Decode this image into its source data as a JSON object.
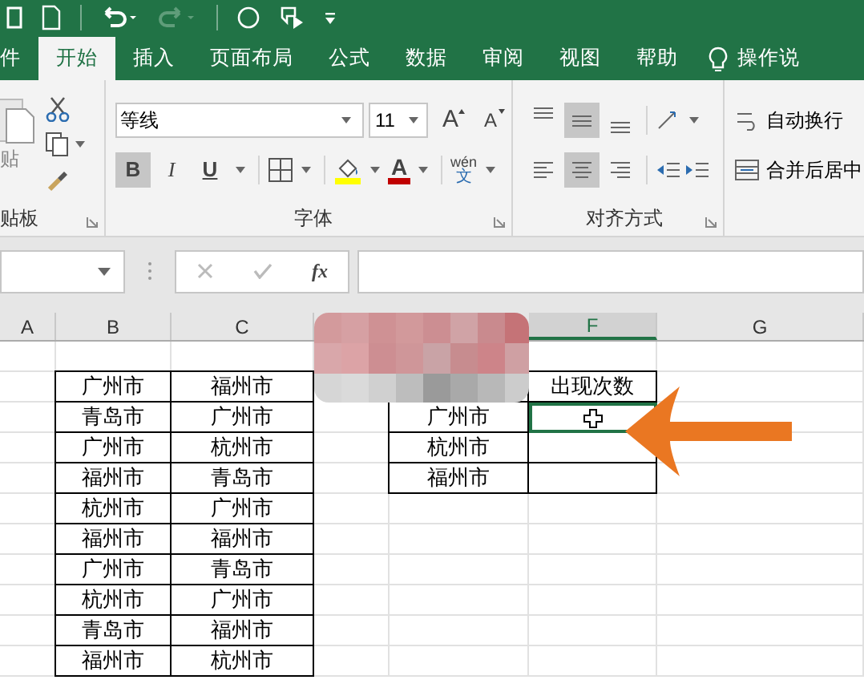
{
  "tabs": [
    {
      "label": "件",
      "selected": false
    },
    {
      "label": "开始",
      "selected": true
    },
    {
      "label": "插入",
      "selected": false
    },
    {
      "label": "页面布局",
      "selected": false
    },
    {
      "label": "公式",
      "selected": false
    },
    {
      "label": "数据",
      "selected": false
    },
    {
      "label": "审阅",
      "selected": false
    },
    {
      "label": "视图",
      "selected": false
    },
    {
      "label": "帮助",
      "selected": false
    }
  ],
  "tell_me": "操作说",
  "clipboard": {
    "paste_label": "贴",
    "group_label": "贴板"
  },
  "font": {
    "font_name": "等线",
    "font_size": "11",
    "grow": "A",
    "shrink": "A",
    "format_buttons": [
      {
        "kind": "bold",
        "label": "B",
        "selected": true
      },
      {
        "kind": "italic",
        "label": "I",
        "selected": false
      },
      {
        "kind": "underline",
        "label": "U",
        "selected": false
      }
    ],
    "font_color_letter": "A",
    "phonetic": "wén",
    "phonetic_char": "文",
    "group_label": "字体"
  },
  "alignment": {
    "vertical": [
      {
        "selected": false
      },
      {
        "selected": true
      },
      {
        "selected": false
      }
    ],
    "horizontal": [
      {
        "selected": false
      },
      {
        "selected": true
      },
      {
        "selected": false
      }
    ],
    "group_label": "对齐方式",
    "wrap_text": "自动换行",
    "merge_center": "合并后居中"
  },
  "formula_bar": {
    "function_label": "fx"
  },
  "sheet": {
    "columns": [
      {
        "label": "A",
        "selected": false
      },
      {
        "label": "B",
        "selected": false
      },
      {
        "label": "C",
        "selected": false
      },
      {
        "label": "F",
        "selected": true
      },
      {
        "label": "G",
        "selected": false
      }
    ],
    "rows": [
      [
        null,
        null,
        null,
        null,
        null,
        null,
        null
      ],
      [
        null,
        {
          "text": "广州市",
          "bordered": true
        },
        {
          "text": "福州市",
          "bordered": true
        },
        null,
        null,
        {
          "text": "出现次数",
          "bordered": true
        },
        null
      ],
      [
        null,
        {
          "text": "青岛市",
          "bordered": true
        },
        {
          "text": "广州市",
          "bordered": true
        },
        null,
        {
          "text": "广州市",
          "bordered": true
        },
        {
          "bordered": true,
          "active": true
        },
        null
      ],
      [
        null,
        {
          "text": "广州市",
          "bordered": true
        },
        {
          "text": "杭州市",
          "bordered": true
        },
        null,
        {
          "text": "杭州市",
          "bordered": true
        },
        {
          "bordered": true
        },
        null
      ],
      [
        null,
        {
          "text": "福州市",
          "bordered": true
        },
        {
          "text": "青岛市",
          "bordered": true
        },
        null,
        {
          "text": "福州市",
          "bordered": true
        },
        {
          "bordered": true
        },
        null
      ],
      [
        null,
        {
          "text": "杭州市",
          "bordered": true
        },
        {
          "text": "广州市",
          "bordered": true
        },
        null,
        null,
        null,
        null
      ],
      [
        null,
        {
          "text": "福州市",
          "bordered": true
        },
        {
          "text": "福州市",
          "bordered": true
        },
        null,
        null,
        null,
        null
      ],
      [
        null,
        {
          "text": "广州市",
          "bordered": true
        },
        {
          "text": "青岛市",
          "bordered": true
        },
        null,
        null,
        null,
        null
      ],
      [
        null,
        {
          "text": "杭州市",
          "bordered": true
        },
        {
          "text": "广州市",
          "bordered": true
        },
        null,
        null,
        null,
        null
      ],
      [
        null,
        {
          "text": "青岛市",
          "bordered": true
        },
        {
          "text": "福州市",
          "bordered": true
        },
        null,
        null,
        null,
        null
      ],
      [
        null,
        {
          "text": "福州市",
          "bordered": true
        },
        {
          "text": "杭州市",
          "bordered": true
        },
        null,
        null,
        null,
        null
      ]
    ]
  }
}
